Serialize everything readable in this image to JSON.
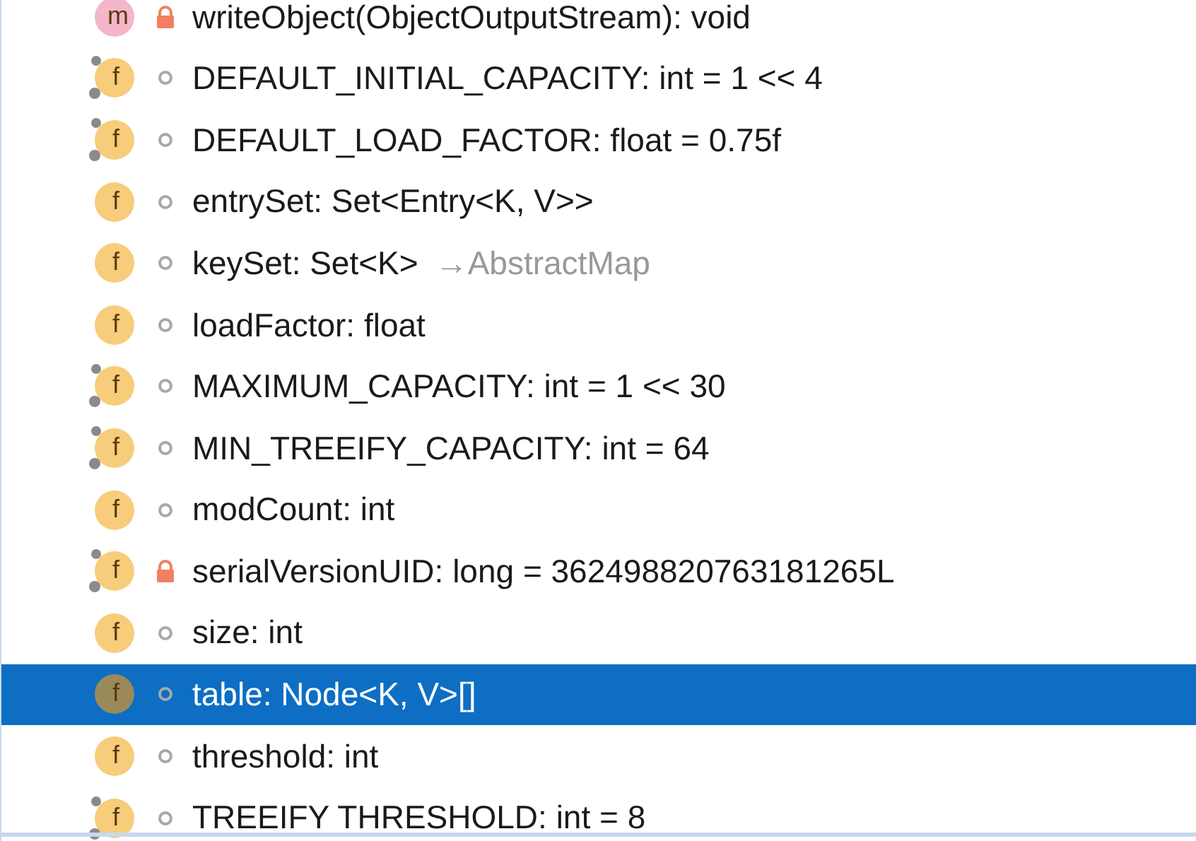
{
  "members": [
    {
      "kind": "method",
      "icon_letter": "m",
      "static": false,
      "private": true,
      "label": "writeObject(ObjectOutputStream): void",
      "selected": false
    },
    {
      "kind": "field",
      "icon_letter": "f",
      "static": true,
      "private": false,
      "label": "DEFAULT_INITIAL_CAPACITY: int = 1 << 4",
      "selected": false
    },
    {
      "kind": "field",
      "icon_letter": "f",
      "static": true,
      "private": false,
      "label": "DEFAULT_LOAD_FACTOR: float = 0.75f",
      "selected": false
    },
    {
      "kind": "field",
      "icon_letter": "f",
      "static": false,
      "private": false,
      "label": "entrySet: Set<Entry<K, V>>",
      "selected": false
    },
    {
      "kind": "field",
      "icon_letter": "f",
      "static": false,
      "private": false,
      "label": "keySet: Set<K>",
      "inherited": "→AbstractMap",
      "selected": false
    },
    {
      "kind": "field",
      "icon_letter": "f",
      "static": false,
      "private": false,
      "label": "loadFactor: float",
      "selected": false
    },
    {
      "kind": "field",
      "icon_letter": "f",
      "static": true,
      "private": false,
      "label": "MAXIMUM_CAPACITY: int = 1 << 30",
      "selected": false
    },
    {
      "kind": "field",
      "icon_letter": "f",
      "static": true,
      "private": false,
      "label": "MIN_TREEIFY_CAPACITY: int = 64",
      "selected": false
    },
    {
      "kind": "field",
      "icon_letter": "f",
      "static": false,
      "private": false,
      "label": "modCount: int",
      "selected": false
    },
    {
      "kind": "field",
      "icon_letter": "f",
      "static": true,
      "private": true,
      "label": "serialVersionUID: long = 362498820763181265L",
      "selected": false
    },
    {
      "kind": "field",
      "icon_letter": "f",
      "static": false,
      "private": false,
      "label": "size: int",
      "selected": false
    },
    {
      "kind": "field",
      "icon_letter": "f",
      "static": false,
      "private": false,
      "label": "table: Node<K, V>[]",
      "selected": true
    },
    {
      "kind": "field",
      "icon_letter": "f",
      "static": false,
      "private": false,
      "label": "threshold: int",
      "selected": false
    },
    {
      "kind": "field",
      "icon_letter": "f",
      "static": true,
      "private": false,
      "label": "TREEIFY THRESHOLD: int = 8",
      "selected": false
    }
  ]
}
